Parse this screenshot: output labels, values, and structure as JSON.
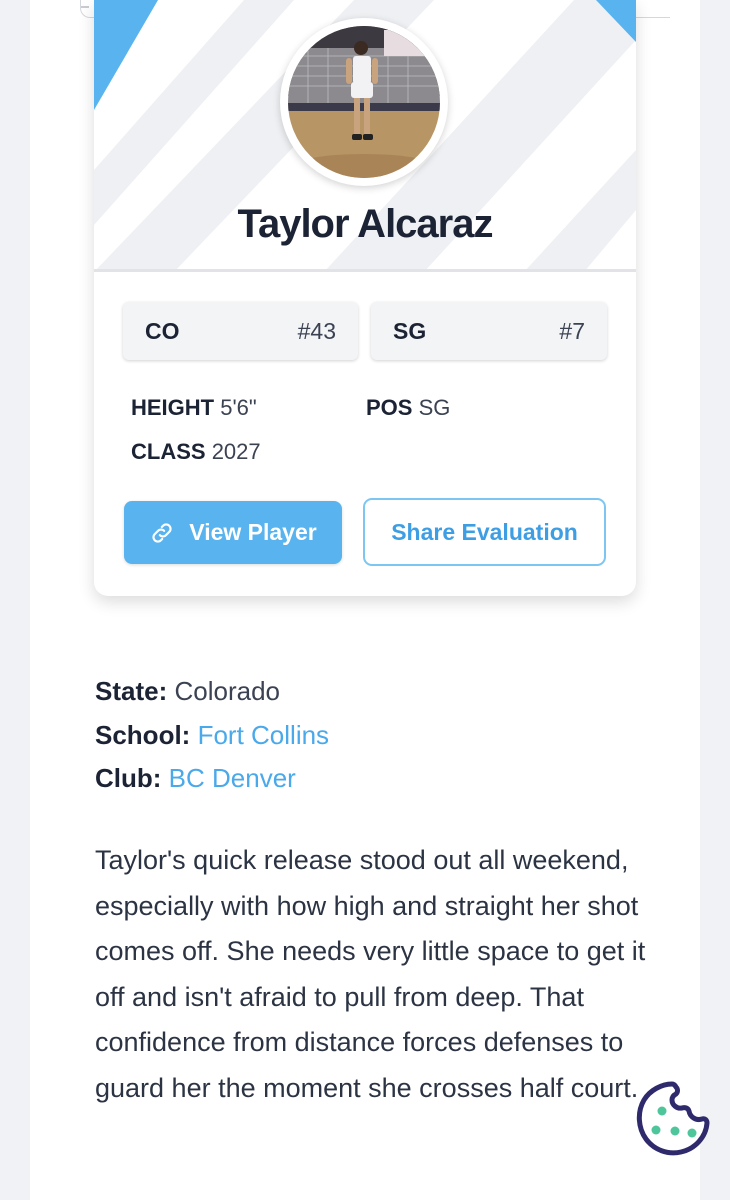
{
  "player": {
    "name": "Taylor Alcaraz"
  },
  "rankings": [
    {
      "label": "CO",
      "value": "#43"
    },
    {
      "label": "SG",
      "value": "#7"
    }
  ],
  "stats": {
    "height_label": "HEIGHT",
    "height_value": "5'6\"",
    "pos_label": "POS",
    "pos_value": "SG",
    "class_label": "CLASS",
    "class_value": "2027"
  },
  "actions": {
    "view_player": "View Player",
    "share_evaluation": "Share Evaluation",
    "link_icon": "link-icon"
  },
  "details": {
    "state_label": "State:",
    "state_value": "Colorado",
    "school_label": "School:",
    "school_value": "Fort Collins",
    "club_label": "Club:",
    "club_value": "BC Denver"
  },
  "bio": "Taylor's quick release stood out all weekend, especially with how high and straight her shot comes off. She needs very little space to get it off and isn't afraid to pull from deep. That confidence from distance forces defenses to guard her the moment she crosses half court.",
  "colors": {
    "accent": "#58b3ef",
    "link": "#4aa9ea",
    "cookie": "#2e2a6b",
    "cookie_dots": "#4ec59a"
  },
  "icons": {
    "cookie": "cookie-icon"
  }
}
